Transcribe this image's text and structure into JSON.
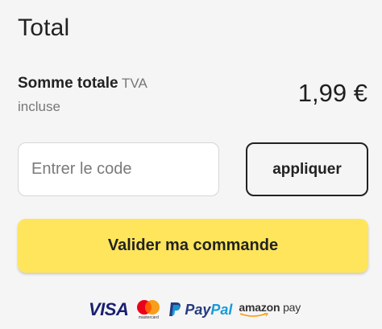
{
  "title": "Total",
  "summary": {
    "label": "Somme totale",
    "tax_note_1": "TVA",
    "tax_note_2": "incluse",
    "amount": "1,99 €"
  },
  "promo": {
    "placeholder": "Entrer le code",
    "value": "",
    "apply_label": "appliquer"
  },
  "checkout": {
    "button_label": "Valider ma commande",
    "button_color": "#ffe55c"
  },
  "payment_methods": {
    "visa": "VISA",
    "mastercard_caption": "mastercard",
    "paypal_pay": "Pay",
    "paypal_pal": "Pal",
    "amazon_brand": "amazon",
    "amazon_pay": "pay"
  }
}
